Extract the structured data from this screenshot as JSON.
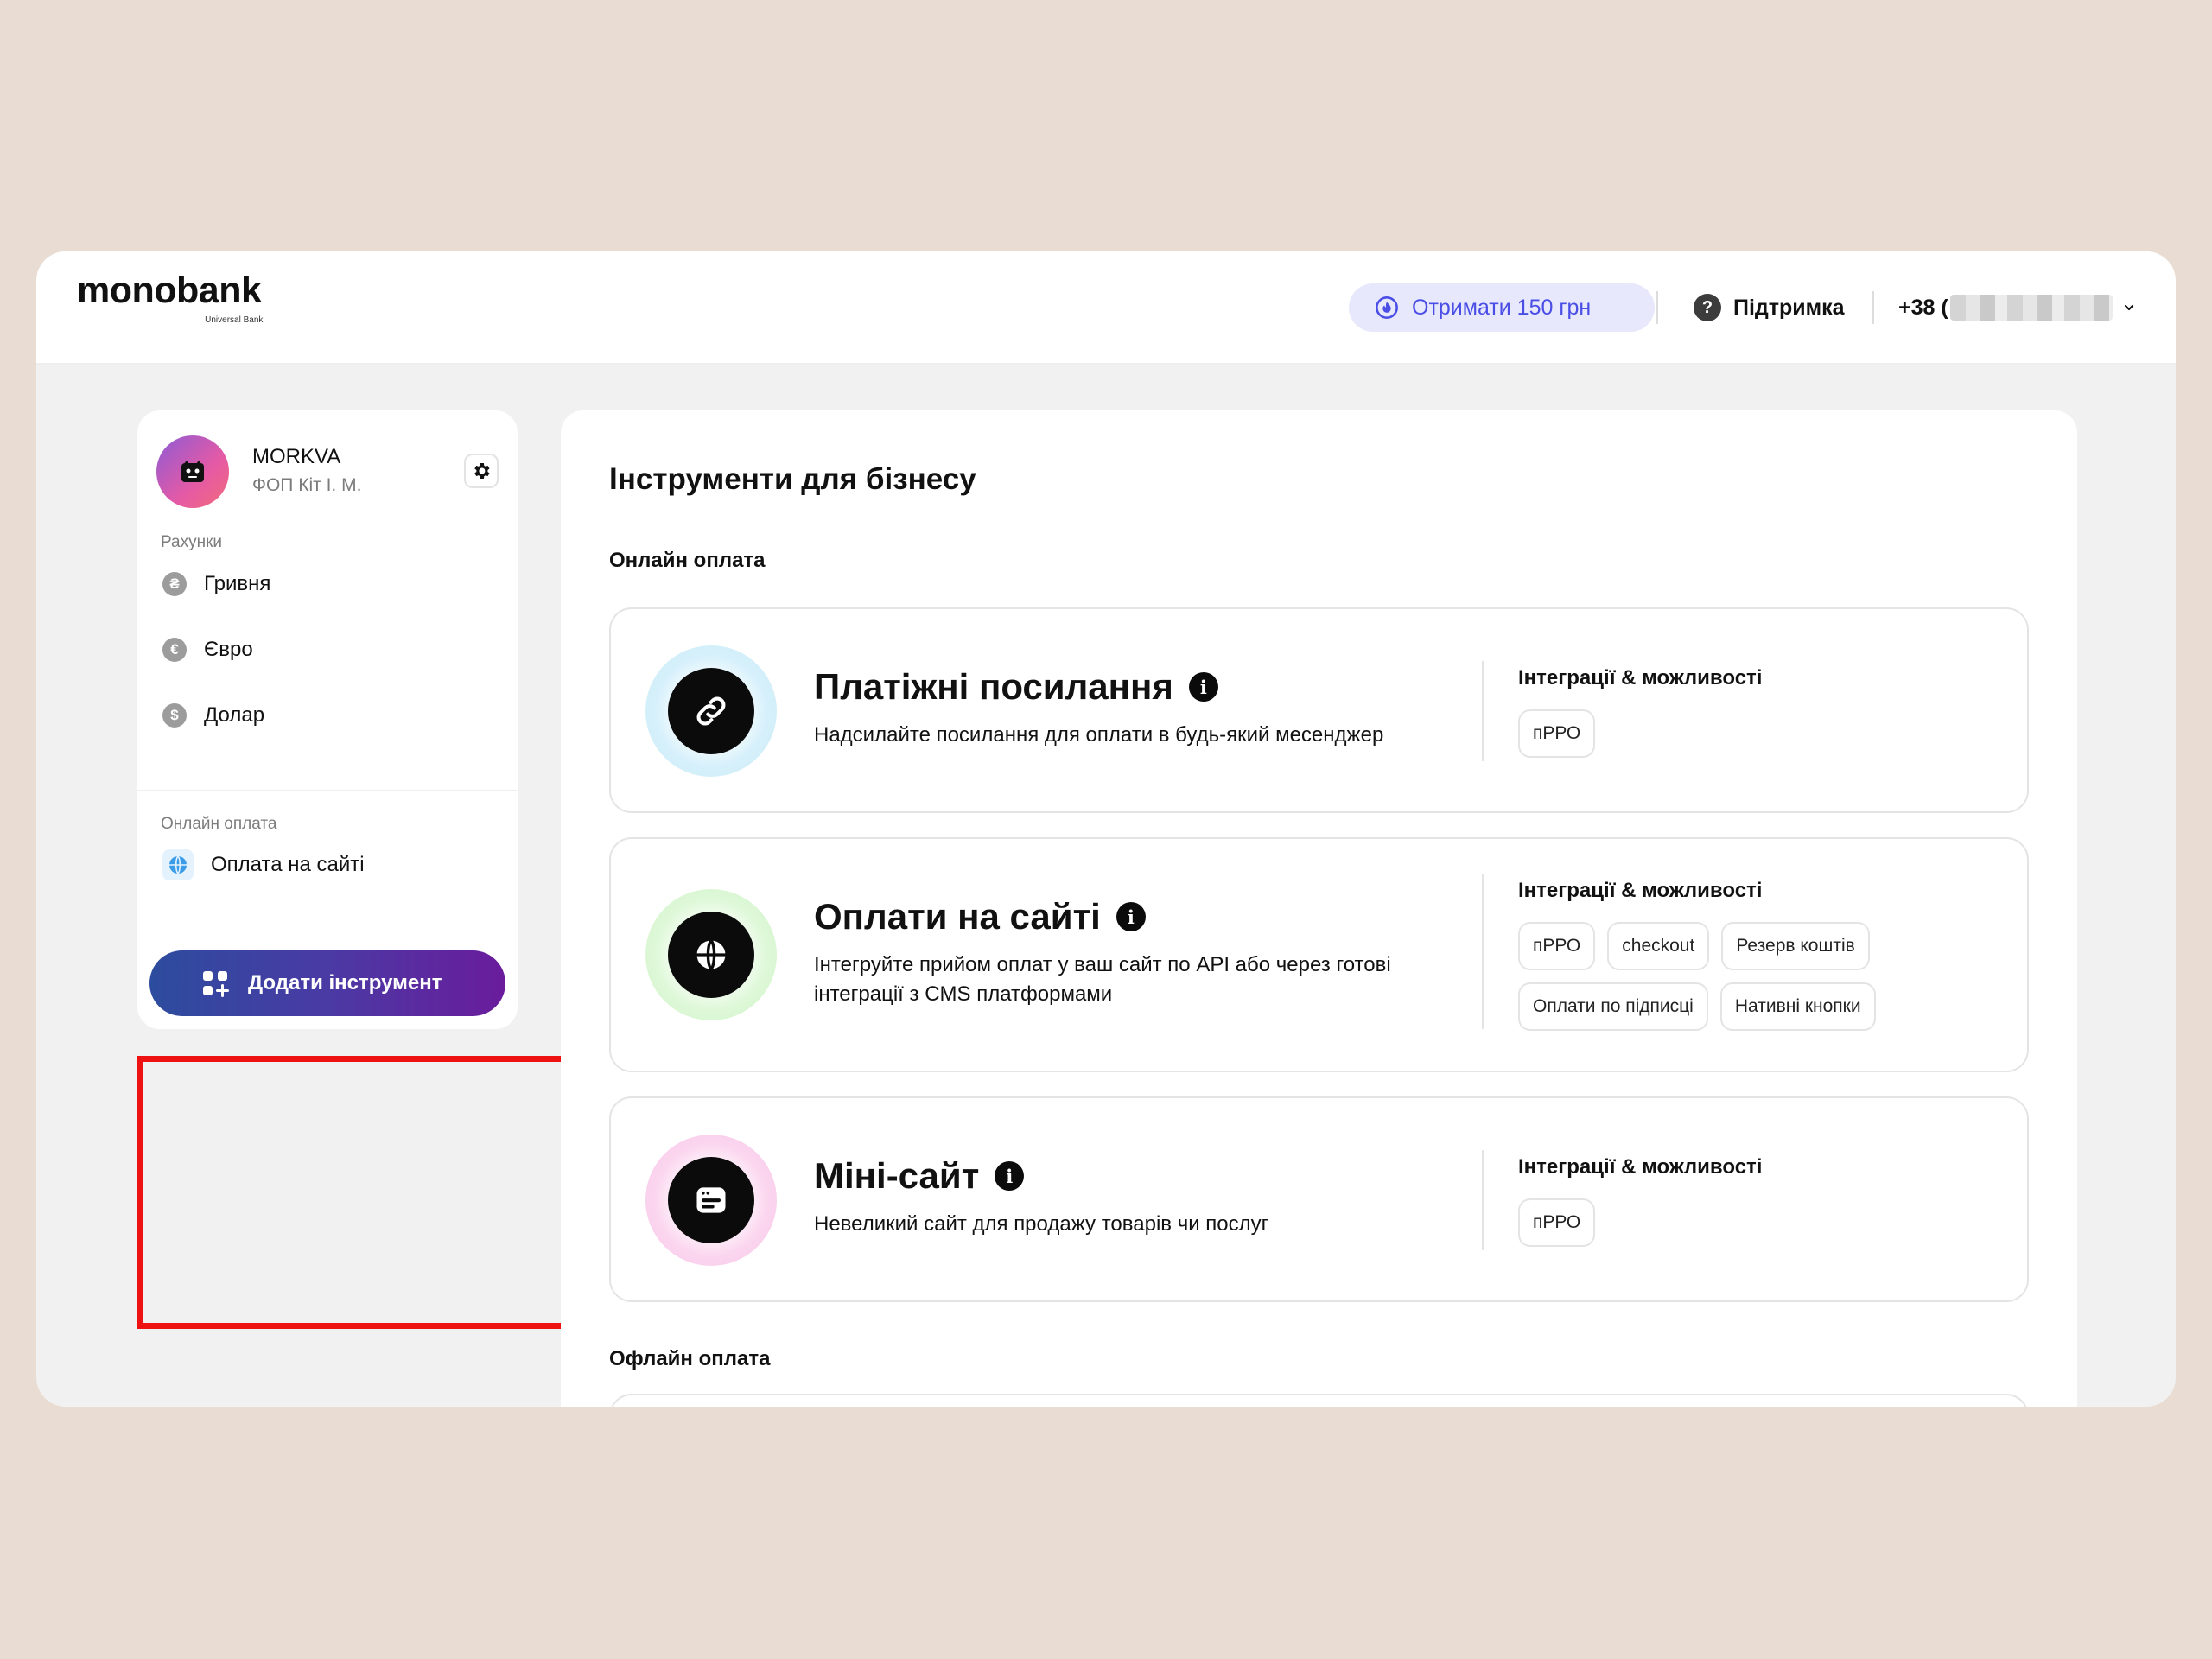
{
  "header": {
    "logo": "monobank",
    "logo_sub": "Universal Bank",
    "promo_label": "Отримати 150 грн",
    "support_label": "Підтримка",
    "phone_prefix": "+38 ("
  },
  "sidebar": {
    "shop_name": "MORKVA",
    "shop_owner": "ФОП Кіт І. М.",
    "accounts_label": "Рахунки",
    "accounts": [
      {
        "label": "Гривня",
        "symbol": "₴"
      },
      {
        "label": "Євро",
        "symbol": "€"
      },
      {
        "label": "Долар",
        "symbol": "$"
      }
    ],
    "online_label": "Онлайн оплата",
    "online_items": [
      {
        "label": "Оплата на сайті"
      }
    ],
    "add_button": "Додати інструмент"
  },
  "main": {
    "title": "Інструменти для бізнесу",
    "online_group": "Онлайн оплата",
    "offline_group": "Офлайн оплата",
    "integrations_label": "Інтеграції & можливості",
    "tools": [
      {
        "title": "Платіжні посилання",
        "desc": "Надсилайте посилання для оплати в будь-який месенджер",
        "chips": [
          "пРРО"
        ],
        "icon": "link-icon",
        "halo": "#d9f1fb"
      },
      {
        "title": "Оплати на сайті",
        "desc": "Інтегруйте прийом оплат у ваш сайт по API або через готові інтеграції з CMS платформами",
        "chips": [
          "пРРО",
          "checkout",
          "Резерв коштів",
          "Оплати по підписці",
          "Нативні кнопки"
        ],
        "icon": "globe-icon",
        "halo": "#dff7d9"
      },
      {
        "title": "Міні-сайт",
        "desc": "Невеликий сайт для продажу товарів чи послуг",
        "chips": [
          "пРРО"
        ],
        "icon": "storefront-icon",
        "halo": "#fbd6ef"
      }
    ]
  },
  "colors": {
    "accent": "#4a4ee6",
    "highlight": "#ee1111",
    "button_start": "#2c4c9e",
    "button_end": "#6a1c9c"
  }
}
